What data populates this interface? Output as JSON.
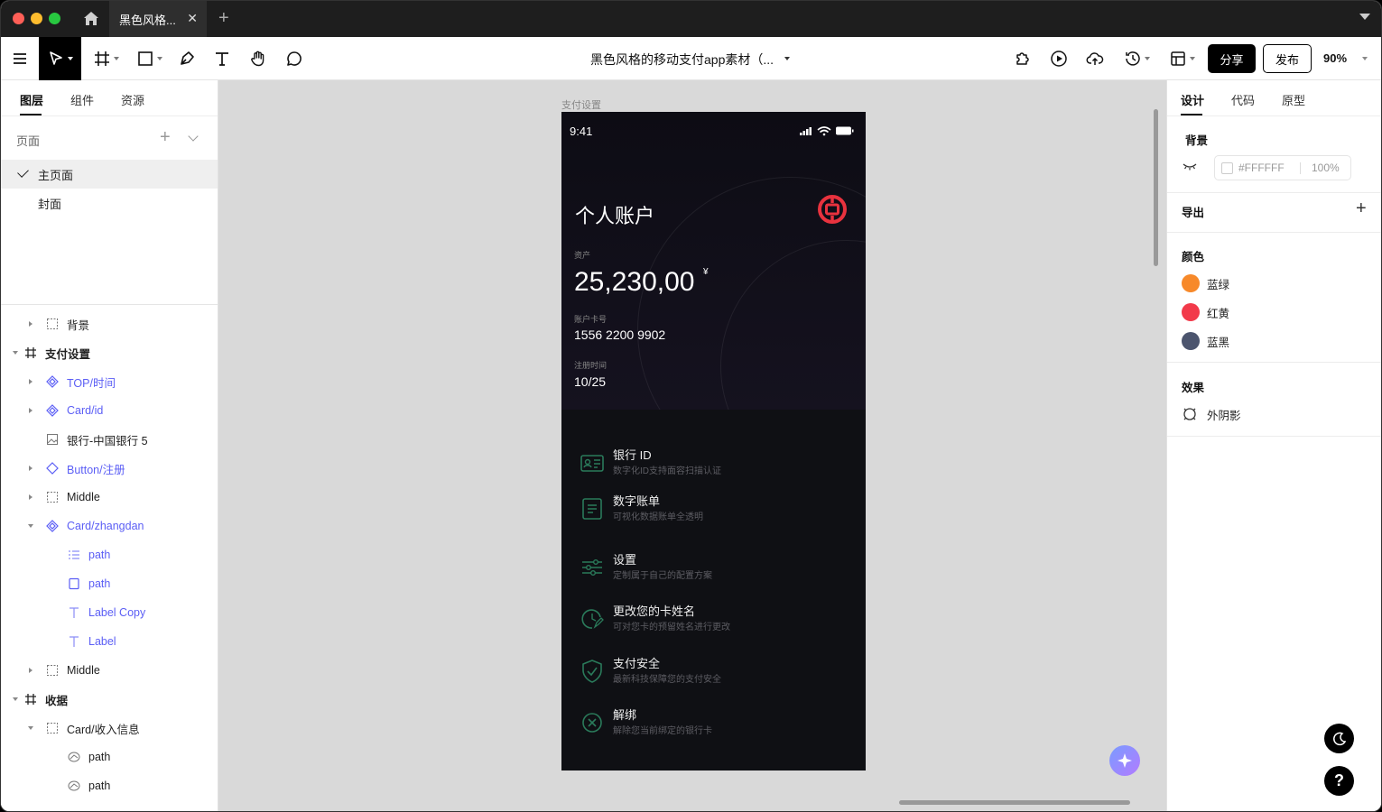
{
  "tabs": [
    {
      "label": "黑色风格..."
    }
  ],
  "toolbar": {
    "doc_title": "黑色风格的移动支付app素材（...",
    "share_label": "分享",
    "publish_label": "发布",
    "zoom": "90%"
  },
  "left_panel": {
    "tabs": [
      {
        "label": "图层"
      },
      {
        "label": "组件"
      },
      {
        "label": "资源"
      }
    ],
    "pages_label": "页面",
    "pages": [
      {
        "label": "主页面",
        "selected": true
      },
      {
        "label": "封面",
        "selected": false
      }
    ],
    "layers": [
      {
        "label": "背景"
      },
      {
        "label": "支付设置"
      },
      {
        "label": "TOP/时间"
      },
      {
        "label": "Card/id"
      },
      {
        "label": "银行-中国银行 5"
      },
      {
        "label": "Button/注册"
      },
      {
        "label": "Middle"
      },
      {
        "label": "Card/zhangdan"
      },
      {
        "label": "path"
      },
      {
        "label": "path"
      },
      {
        "label": "Label Copy"
      },
      {
        "label": "Label"
      },
      {
        "label": "Middle"
      },
      {
        "label": "收据"
      },
      {
        "label": "Card/收入信息"
      },
      {
        "label": "path"
      },
      {
        "label": "path"
      }
    ]
  },
  "canvas": {
    "frame_label": "支付设置",
    "phone": {
      "time": "9:41",
      "title": "个人账户",
      "assets_label": "资产",
      "amount": "25,230,00",
      "currency": "¥",
      "card_label": "账户卡号",
      "card_number": "1556 2200 9902",
      "reg_label": "注册时间",
      "reg_date": "10/25",
      "menu": [
        {
          "title": "银行 ID",
          "subtitle": "数字化ID支持面容扫描认证",
          "icon": "id-card-icon"
        },
        {
          "title": "数字账单",
          "subtitle": "可视化数据账单全透明",
          "icon": "bill-icon"
        },
        {
          "title": "设置",
          "subtitle": "定制属于自己的配置方案",
          "icon": "sliders-icon"
        },
        {
          "title": "更改您的卡姓名",
          "subtitle": "可对您卡的预留姓名进行更改",
          "icon": "edit-clock-icon"
        },
        {
          "title": "支付安全",
          "subtitle": "最新科技保障您的支付安全",
          "icon": "shield-check-icon"
        },
        {
          "title": "解绑",
          "subtitle": "解除您当前绑定的银行卡",
          "icon": "close-circle-icon"
        }
      ]
    }
  },
  "right_panel": {
    "tabs": [
      {
        "label": "设计"
      },
      {
        "label": "代码"
      },
      {
        "label": "原型"
      }
    ],
    "background_title": "背景",
    "background_hex": "#FFFFFF",
    "background_opacity": "100%",
    "export_title": "导出",
    "colors_title": "颜色",
    "colors": [
      {
        "name": "蓝绿",
        "hex": "#f7892a"
      },
      {
        "name": "红黄",
        "hex": "#f23a4a"
      },
      {
        "name": "蓝黑",
        "hex": "#4c556e"
      }
    ],
    "effects_title": "效果",
    "effects": [
      {
        "name": "外阴影"
      }
    ]
  },
  "accent_green": "#2a7a5a"
}
